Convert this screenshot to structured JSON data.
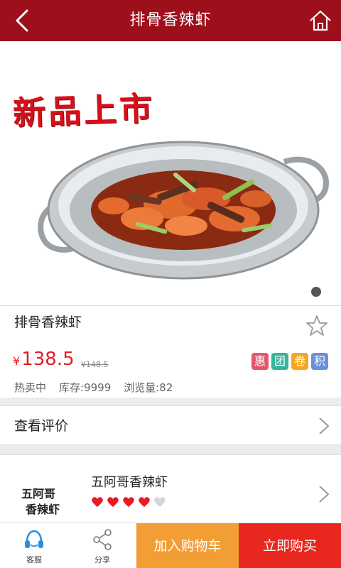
{
  "header": {
    "title": "排骨香辣虾"
  },
  "hero": {
    "banner_text": "新品上市"
  },
  "product": {
    "name": "排骨香辣虾",
    "currency": "¥",
    "price": "138.5",
    "old_price": "¥148.5",
    "tags": [
      {
        "label": "惠",
        "color": "#e5566b"
      },
      {
        "label": "团",
        "color": "#3bb39a"
      },
      {
        "label": "卷",
        "color": "#f5a623"
      },
      {
        "label": "积",
        "color": "#6c8fd6"
      }
    ],
    "stats": [
      "热卖中",
      "库存:9999",
      "浏览量:82"
    ]
  },
  "review": {
    "label": "查看评价"
  },
  "shop": {
    "logo_text_line1": "五阿哥",
    "logo_text_line2": "香辣虾",
    "name": "五阿哥香辣虾",
    "rating": 4
  },
  "bottombar": {
    "service_label": "客服",
    "share_label": "分享",
    "cart_label": "加入购物车",
    "buy_label": "立即购买"
  },
  "colors": {
    "header": "#9e0f1c",
    "price": "#e51c23",
    "cart": "#f39d35",
    "buy": "#e8281f"
  }
}
